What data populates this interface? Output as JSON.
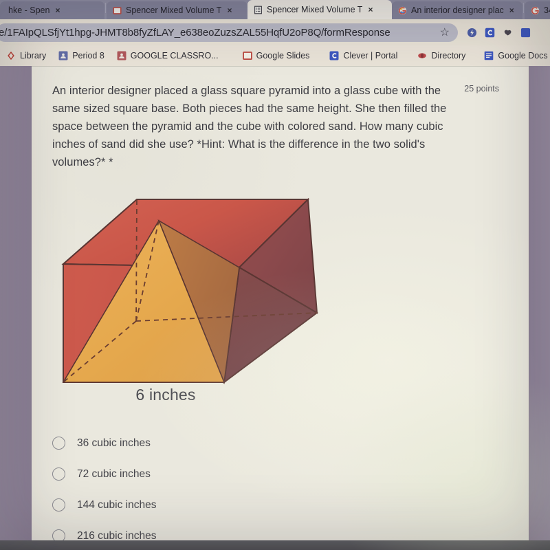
{
  "browser": {
    "tabs": [
      {
        "title": "hke - Spen",
        "icon": "none",
        "active": false,
        "close": "×"
      },
      {
        "title": "Spencer Mixed Volume T",
        "icon": "slides-icon",
        "active": false,
        "close": "×"
      },
      {
        "title": "Spencer Mixed Volume T",
        "icon": "forms-icon",
        "active": true,
        "close": "×"
      },
      {
        "title": "An interior designer plac",
        "icon": "google-g-icon",
        "active": false,
        "close": "×"
      },
      {
        "title": "34",
        "icon": "google-g-icon",
        "active": false,
        "close": ""
      }
    ],
    "omnibox": {
      "url": "e/1FAIpQLSfjYt1hpg-JHMT8b8fyZfLAY_e638eoZuzsZAL55HqfU2oP8Q/formResponse",
      "star": "☆"
    },
    "extensions": [
      "extension-blue-icon",
      "clever-c-icon",
      "extension-dark-icon",
      "extension-blue2-icon"
    ],
    "bookmarks": [
      {
        "label": "Library",
        "icon": "diamond-icon"
      },
      {
        "label": "Period 8",
        "icon": "classroom-icon"
      },
      {
        "label": "GOOGLE CLASSRO...",
        "icon": "classroom-icon"
      },
      {
        "label": "Google Slides",
        "icon": "slides-icon"
      },
      {
        "label": "Clever | Portal",
        "icon": "clever-c-icon"
      },
      {
        "label": "Directory",
        "icon": "directory-icon"
      },
      {
        "label": "Google Docs",
        "icon": "docs-icon"
      }
    ]
  },
  "form": {
    "question": "An interior designer placed a glass square pyramid into a glass cube with the same sized square base. Both pieces had the same height. She then filled the space between the pyramid and the cube with colored sand. How many cubic inches of sand did she use? *Hint: What is the difference in the two solid's volumes?* *",
    "points": "25 points",
    "figure_caption": "6 inches",
    "figure": {
      "description": "square pyramid inscribed in a transparent cube",
      "cube_face_top": "#d4584a",
      "cube_face_left": "#cf5344",
      "cube_face_right": "#8e4a4c",
      "cube_face_right_dark": "#7a4046",
      "pyramid_front": "#eead4e",
      "pyramid_right": "#b7713f",
      "edge_color": "#5a3330"
    },
    "options": [
      {
        "label": "36 cubic inches",
        "selected": false
      },
      {
        "label": "72 cubic inches",
        "selected": false
      },
      {
        "label": "144 cubic inches",
        "selected": false
      },
      {
        "label": "216 cubic inches",
        "selected": false
      }
    ]
  },
  "colors": {
    "page_background": "#8e8298",
    "card_background": "#eceadf",
    "tabstrip": "#8f8fa6",
    "omnibox_background": "#e9e3d6",
    "url_pill": "#b9b9c6",
    "bookmark_bar": "#eae4d8",
    "text_primary": "#3b3b41"
  }
}
